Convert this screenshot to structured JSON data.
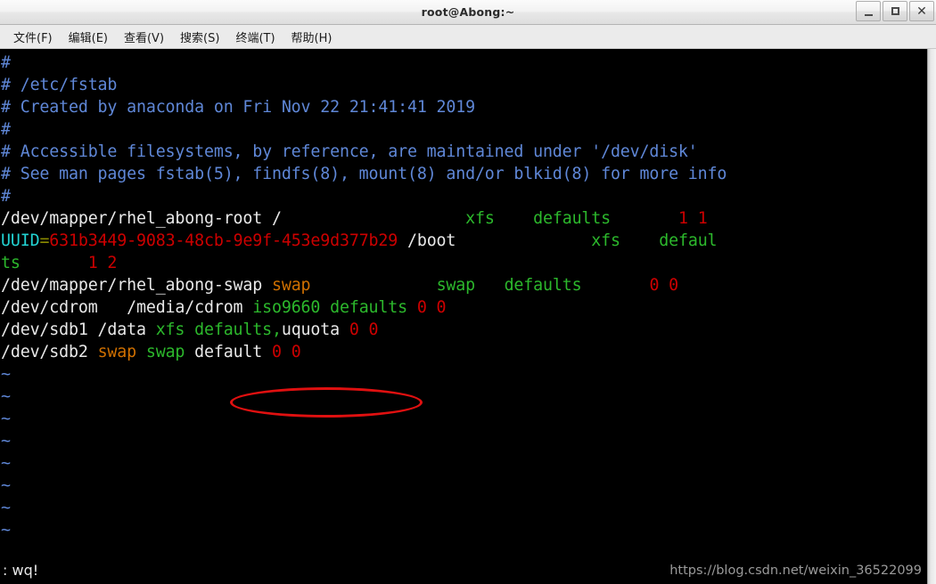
{
  "window": {
    "title": "root@Abong:~",
    "buttons": [
      {
        "name": "minimize-button",
        "label": "_"
      },
      {
        "name": "maximize-button",
        "label": "□"
      },
      {
        "name": "close-button",
        "label": "✕"
      }
    ]
  },
  "menubar": {
    "items": [
      {
        "label": "文件(F)",
        "name": "menu-file"
      },
      {
        "label": "编辑(E)",
        "name": "menu-edit"
      },
      {
        "label": "查看(V)",
        "name": "menu-view"
      },
      {
        "label": "搜索(S)",
        "name": "menu-search"
      },
      {
        "label": "终端(T)",
        "name": "menu-terminal"
      },
      {
        "label": "帮助(H)",
        "name": "menu-help"
      }
    ]
  },
  "terminal": {
    "file": "/etc/fstab",
    "lines": {
      "l1": "#",
      "l2": "# /etc/fstab",
      "l3": "# Created by anaconda on Fri Nov 22 21:41:41 2019",
      "l4": "#",
      "l5": "# Accessible filesystems, by reference, are maintained under '/dev/disk'",
      "l6": "# See man pages fstab(5), findfs(8), mount(8) and/or blkid(8) for more info",
      "l7": "#",
      "l8_device": "/dev/mapper/rhel_abong-root /",
      "l8_fstype": "xfs",
      "l8_options": "defaults",
      "l8_dumppass": "1 1",
      "l9_uuid_key": "UUID",
      "l9_eq": "=",
      "l9_uuid_value": "631b3449-9083-48cb-9e9f-453e9d377b29",
      "l9_mount": "/boot",
      "l9_fstype": "xfs",
      "l9_options_part1": "defaul",
      "l10_options_part2": "ts",
      "l10_dumppass": "1 2",
      "l11_device": "/dev/mapper/rhel_abong-swap ",
      "l11_mount": "swap",
      "l11_fstype": "swap",
      "l11_options": "defaults",
      "l11_dumppass": "0 0",
      "l12_device": "/dev/cdrom   /media/cdrom ",
      "l12_fstype": "iso9660",
      "l12_options": " defaults ",
      "l12_dumppass": "0 0",
      "l13_device": "/dev/sdb1 /data ",
      "l13_fstype": "xfs",
      "l13_options_green": " defaults,",
      "l13_options_white": "uquota",
      "l13_dumppass": "0 0",
      "l14_device": "/dev/sdb2 ",
      "l14_mount": "swap",
      "l14_fstype": "swap",
      "l14_options": " default ",
      "l14_dumppass": "0 0",
      "tilde": "~"
    },
    "status_command": ": wq!",
    "watermark": "https://blog.csdn.net/weixin_36522099"
  },
  "colors": {
    "comment_blue": "#5f87d7",
    "uuid_cyan": "#22d2d2",
    "value_red": "#cc0000",
    "fstype_green": "#2cb82c",
    "mount_orange": "#d07000",
    "annotation_red": "#e01010",
    "background": "#000000"
  }
}
